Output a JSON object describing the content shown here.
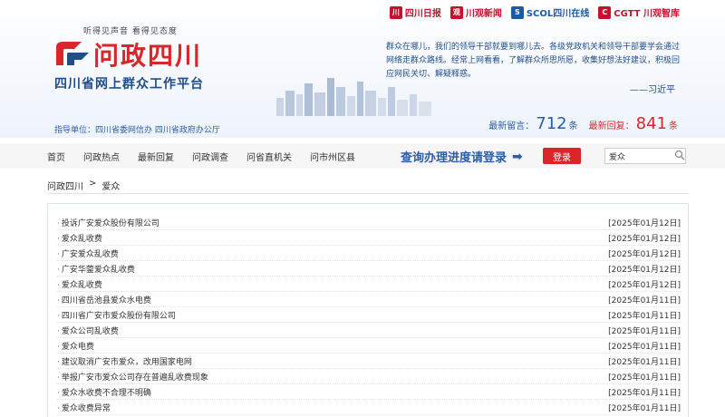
{
  "header": {
    "slogan": "听得见声音 看得见态度",
    "logo_title": "问政四川",
    "logo_subtitle": "四川省网上群众工作平台",
    "guidance": "指导单位：四川省委网信办 四川省政府办公厅",
    "partners": [
      {
        "icon": "sichuan-daily-logo",
        "label": "四川日报"
      },
      {
        "icon": "chuanguan-news-logo",
        "label": "川观新闻"
      },
      {
        "icon": "scol-logo",
        "label": "SCOL四川在线"
      },
      {
        "icon": "cgtt-logo",
        "label": "CGTT 川观智库"
      }
    ],
    "quote": "群众在哪儿，我们的领导干部就要到哪儿去。各级党政机关和领导干部要学会通过网络走群众路线。经常上网看看，了解群众所思所愿，收集好想法好建议，积极回应网民关切、解疑释惑。",
    "quote_author": "——习近平",
    "stats": {
      "latest_msg_label": "最新留言：",
      "latest_msg_count": "712",
      "latest_msg_unit": "条",
      "latest_reply_label": "最新回复：",
      "latest_reply_count": "841",
      "latest_reply_unit": "条"
    }
  },
  "nav": {
    "items": [
      "首页",
      "问政热点",
      "最新回复",
      "问政调查",
      "问省直机关",
      "问市州区县"
    ],
    "progress_link": "查询办理进度请登录",
    "login_label": "登录",
    "search_value": "爱众"
  },
  "breadcrumb": [
    "问政四川",
    ">",
    "爱众"
  ],
  "list": [
    {
      "title": "投诉广安爱众股份有限公司",
      "date": "[2025年01月12日]"
    },
    {
      "title": "爱众乱收费",
      "date": "[2025年01月12日]"
    },
    {
      "title": "广安爱众乱收费",
      "date": "[2025年01月12日]"
    },
    {
      "title": "广安华蓥爱众乱收费",
      "date": "[2025年01月12日]"
    },
    {
      "title": "爱众乱收费",
      "date": "[2025年01月12日]"
    },
    {
      "title": "四川省岳池县爱众水电费",
      "date": "[2025年01月11日]"
    },
    {
      "title": "四川省广安市爱众股份有限公司",
      "date": "[2025年01月11日]"
    },
    {
      "title": "爱众公司乱收费",
      "date": "[2025年01月11日]"
    },
    {
      "title": "爱众电费",
      "date": "[2025年01月11日]"
    },
    {
      "title": "建议取消广安市爱众，改用国家电网",
      "date": "[2025年01月11日]"
    },
    {
      "title": "举报广安市爱众公司存在普遍乱收费现象",
      "date": "[2025年01月11日]"
    },
    {
      "title": "爱众水收费不合理不明确",
      "date": "[2025年01月11日]"
    },
    {
      "title": "爱众收费异常",
      "date": "[2025年01月11日]"
    }
  ]
}
